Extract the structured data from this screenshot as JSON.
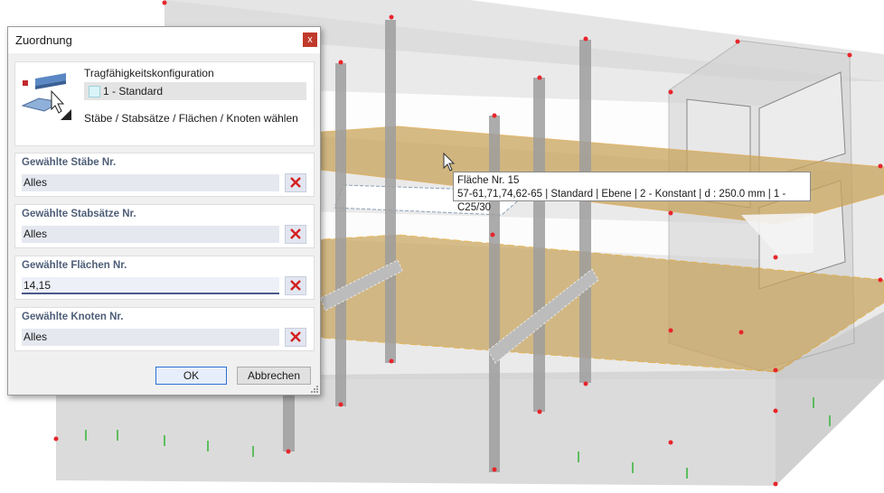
{
  "dialog": {
    "title": "Zuordnung",
    "close_label": "x",
    "config": {
      "label": "Tragfähigkeitskonfiguration",
      "selected": "1 - Standard",
      "hint": "Stäbe / Stabsätze / Flächen / Knoten wählen",
      "icon": "member-surface-selection-icon"
    },
    "sections": [
      {
        "label": "Gewählte Stäbe Nr.",
        "value": "Alles"
      },
      {
        "label": "Gewählte Stabsätze Nr.",
        "value": "Alles"
      },
      {
        "label": "Gewählte Flächen Nr.",
        "value": "14,15"
      },
      {
        "label": "Gewählte Knoten Nr.",
        "value": "Alles"
      }
    ],
    "ok_label": "OK",
    "cancel_label": "Abbrechen"
  },
  "tooltip": {
    "line1": "Fläche Nr. 15",
    "line2": "57-61,71,74,62-65 | Standard | Ebene | 2 - Konstant | d : 250.0 mm | 1 - C25/30"
  },
  "colors": {
    "selected_surface": "#c8a45c",
    "node": "#e8242b",
    "dialog_accent": "#4e5e78",
    "clear_icon": "#d42020"
  }
}
